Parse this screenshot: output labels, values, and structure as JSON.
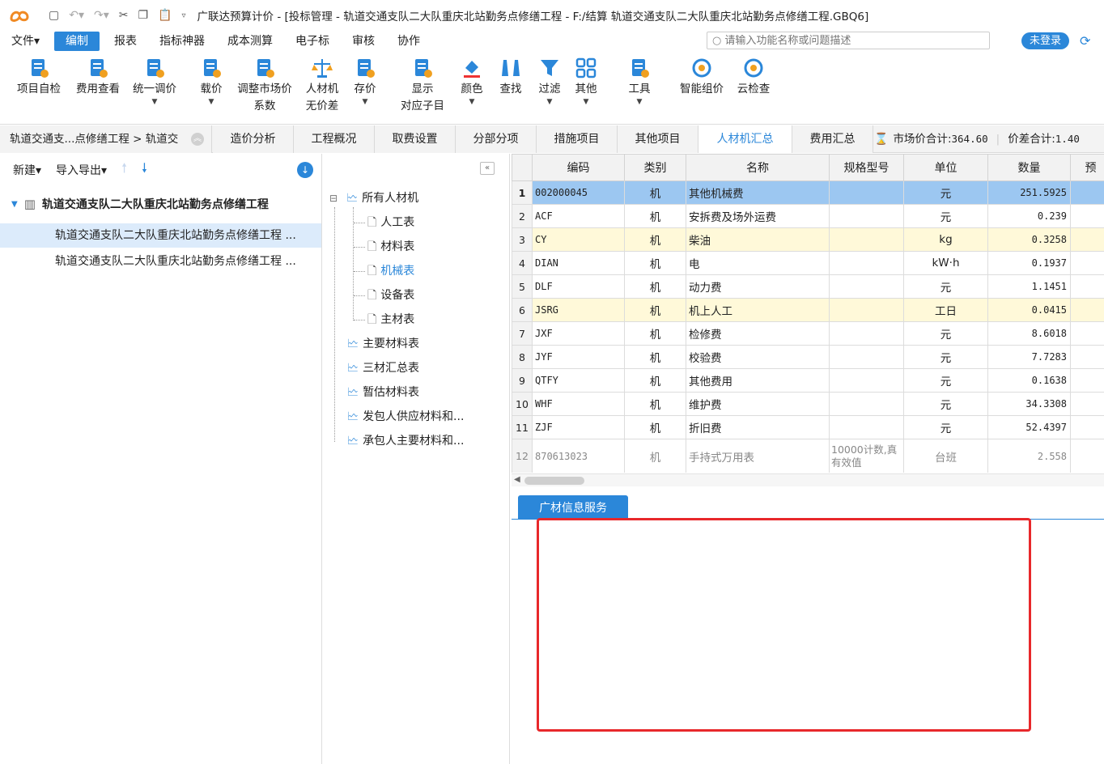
{
  "titlebar": {
    "title": "广联达预算计价 - [投标管理 - 轨道交通支队二大队重庆北站勤务点修缮工程 - F:/结算  轨道交通支队二大队重庆北站勤务点修缮工程.GBQ6]"
  },
  "menu": {
    "items": [
      "文件▾",
      "编制",
      "报表",
      "指标神器",
      "成本测算",
      "电子标",
      "审核",
      "协作"
    ],
    "active_index": 1,
    "search_placeholder": "请输入功能名称或问题描述",
    "login_label": "未登录"
  },
  "ribbon": {
    "buttons": [
      {
        "label1": "项目自检",
        "label2": "",
        "caret": false,
        "icon": "check-doc-icon"
      },
      {
        "label1": "费用查看",
        "label2": "",
        "caret": false,
        "icon": "fee-view-icon"
      },
      {
        "label1": "统一调价",
        "label2": "",
        "caret": true,
        "icon": "adjust-price-icon"
      },
      {
        "label1": "载价",
        "label2": "",
        "caret": true,
        "icon": "load-price-icon"
      },
      {
        "label1": "调整市场价",
        "label2": "系数",
        "caret": false,
        "icon": "market-coef-icon"
      },
      {
        "label1": "人材机",
        "label2": "无价差",
        "caret": false,
        "icon": "scale-icon"
      },
      {
        "label1": "存价",
        "label2": "",
        "caret": true,
        "icon": "save-price-icon"
      },
      {
        "label1": "显示",
        "label2": "对应子目",
        "caret": false,
        "icon": "show-items-icon"
      },
      {
        "label1": "颜色",
        "label2": "",
        "caret": true,
        "icon": "color-bucket-icon"
      },
      {
        "label1": "查找",
        "label2": "",
        "caret": false,
        "icon": "binoculars-icon"
      },
      {
        "label1": "过滤",
        "label2": "",
        "caret": true,
        "icon": "filter-icon"
      },
      {
        "label1": "其他",
        "label2": "",
        "caret": true,
        "icon": "grid-apps-icon"
      },
      {
        "label1": "工具",
        "label2": "",
        "caret": true,
        "icon": "tools-icon"
      },
      {
        "label1": "智能组价",
        "label2": "",
        "caret": false,
        "icon": "smart-price-icon"
      },
      {
        "label1": "云检查",
        "label2": "",
        "caret": false,
        "icon": "cloud-check-icon"
      }
    ]
  },
  "tabs": {
    "breadcrumb": "轨道交通支...点修缮工程 > 轨道交",
    "items": [
      "造价分析",
      "工程概况",
      "取费设置",
      "分部分项",
      "措施项目",
      "其他项目",
      "人材机汇总",
      "费用汇总"
    ],
    "active_index": 6,
    "market_total_label": "市场价合计",
    "market_total_value": "364.60",
    "diff_total_label": "价差合计",
    "diff_total_value": "1.40"
  },
  "left_panel": {
    "new_label": "新建▾",
    "import_export_label": "导入导出▾",
    "root_project": "轨道交通支队二大队重庆北站勤务点修缮工程",
    "children": [
      "轨道交通支队二大队重庆北站勤务点修缮工程 ...",
      "轨道交通支队二大队重庆北站勤务点修缮工程 ..."
    ]
  },
  "tree": {
    "root": "所有人材机",
    "sub": [
      "人工表",
      "材料表",
      "机械表",
      "设备表",
      "主材表"
    ],
    "active_sub_index": 2,
    "others": [
      "主要材料表",
      "三材汇总表",
      "暂估材料表",
      "发包人供应材料和...",
      "承包人主要材料和..."
    ]
  },
  "grid": {
    "columns": [
      "编码",
      "类别",
      "名称",
      "规格型号",
      "单位",
      "数量",
      "预"
    ],
    "rows": [
      {
        "no": "1",
        "code": "002000045",
        "type": "机",
        "name": "其他机械费",
        "spec": "",
        "unit": "元",
        "qty": "251.5925",
        "style": "sel"
      },
      {
        "no": "2",
        "code": "ACF",
        "type": "机",
        "name": "安拆费及场外运费",
        "spec": "",
        "unit": "元",
        "qty": "0.239",
        "style": ""
      },
      {
        "no": "3",
        "code": "CY",
        "type": "机",
        "name": "柴油",
        "spec": "",
        "unit": "kg",
        "qty": "0.3258",
        "style": "hl"
      },
      {
        "no": "4",
        "code": "DIAN",
        "type": "机",
        "name": "电",
        "spec": "",
        "unit": "kW·h",
        "qty": "0.1937",
        "style": ""
      },
      {
        "no": "5",
        "code": "DLF",
        "type": "机",
        "name": "动力费",
        "spec": "",
        "unit": "元",
        "qty": "1.1451",
        "style": ""
      },
      {
        "no": "6",
        "code": "JSRG",
        "type": "机",
        "name": "机上人工",
        "spec": "",
        "unit": "工日",
        "qty": "0.0415",
        "style": "hl"
      },
      {
        "no": "7",
        "code": "JXF",
        "type": "机",
        "name": "检修费",
        "spec": "",
        "unit": "元",
        "qty": "8.6018",
        "style": ""
      },
      {
        "no": "8",
        "code": "JYF",
        "type": "机",
        "name": "校验费",
        "spec": "",
        "unit": "元",
        "qty": "7.7283",
        "style": ""
      },
      {
        "no": "9",
        "code": "QTFY",
        "type": "机",
        "name": "其他费用",
        "spec": "",
        "unit": "元",
        "qty": "0.1638",
        "style": ""
      },
      {
        "no": "10",
        "code": "WHF",
        "type": "机",
        "name": "维护费",
        "spec": "",
        "unit": "元",
        "qty": "34.3308",
        "style": ""
      },
      {
        "no": "11",
        "code": "ZJF",
        "type": "机",
        "name": "折旧费",
        "spec": "",
        "unit": "元",
        "qty": "52.4397",
        "style": ""
      },
      {
        "no": "12",
        "code": "870613023",
        "type": "机",
        "name": "手持式万用表",
        "spec": "10000计数,真有效值",
        "unit": "台班",
        "qty": "2.558",
        "style": "gray"
      }
    ]
  },
  "info_panel": {
    "tab_label": "广材信息服务"
  },
  "colors": {
    "accent": "#2b87d9",
    "selected_row": "#9cc7f1",
    "highlight_row": "#fff9d9",
    "red_box": "#e8282b"
  }
}
